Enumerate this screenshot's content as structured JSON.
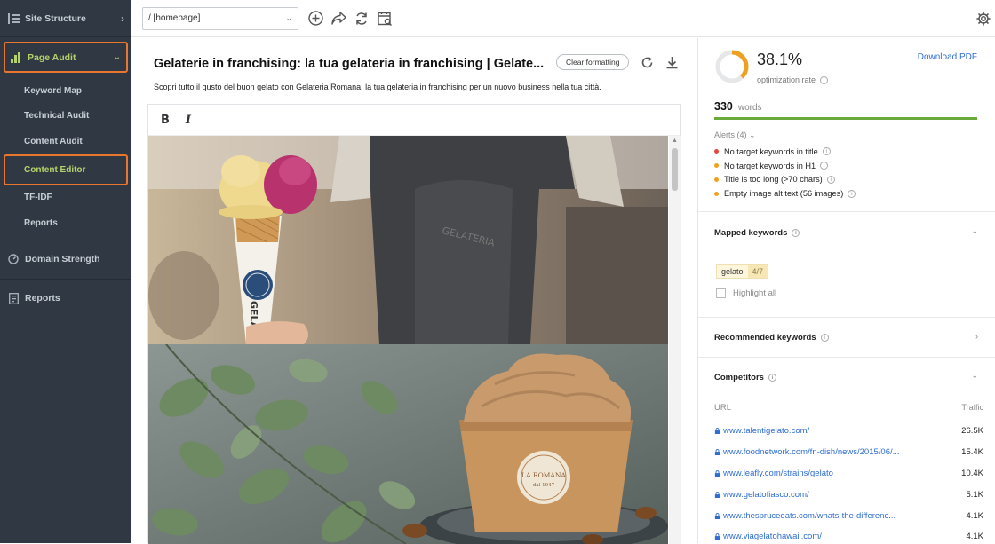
{
  "sidebar": {
    "site_structure": "Site Structure",
    "page_audit": "Page Audit",
    "sub_items": [
      "Keyword Map",
      "Technical Audit",
      "Content Audit",
      "Content Editor",
      "TF-IDF",
      "Reports"
    ],
    "domain_strength": "Domain Strength",
    "reports": "Reports"
  },
  "toolbar": {
    "url_value": "/ [homepage]",
    "icons": [
      "add-circle-icon",
      "share-icon",
      "refresh-icon",
      "calendar-search-icon"
    ],
    "settings_icon": "gear-icon"
  },
  "editor": {
    "title": "Gelaterie in franchising: la tua gelateria in franchising | Gelate...",
    "clear_formatting": "Clear formatting",
    "meta_description": "Scopri tutto il gusto del buon gelato con Gelateria Romana: la tua gelateria in franchising per un nuovo business nella tua città.",
    "bold_label": "B",
    "italic_label": "I",
    "cup_brand": "LA ROMANA",
    "cup_year": "dal 1947",
    "cone_text": "GELATO"
  },
  "panel": {
    "score_value": "38.1%",
    "score_fraction": 0.381,
    "score_label": "optimization rate",
    "download_pdf": "Download PDF",
    "word_count": "330",
    "words_label": "words",
    "alerts_header": "Alerts (4)",
    "alerts": [
      {
        "text": "No target keywords in title",
        "color": "#e5473b"
      },
      {
        "text": "No target keywords in H1",
        "color": "#f0a020"
      },
      {
        "text": "Title is too long (>70 chars)",
        "color": "#f0a020"
      },
      {
        "text": "Empty image alt text (56 images)",
        "color": "#f0a020"
      }
    ],
    "mapped_keywords": {
      "title": "Mapped keywords",
      "keyword": "gelato",
      "count": "4/7",
      "highlight_all": "Highlight all"
    },
    "recommended_keywords": {
      "title": "Recommended keywords"
    },
    "competitors": {
      "title": "Competitors",
      "url_header": "URL",
      "traffic_header": "Traffic",
      "rows": [
        {
          "url": "www.talentigelato.com/",
          "traffic": "26.5K"
        },
        {
          "url": "www.foodnetwork.com/fn-dish/news/2015/06/...",
          "traffic": "15.4K"
        },
        {
          "url": "www.leafly.com/strains/gelato",
          "traffic": "10.4K"
        },
        {
          "url": "www.gelatofiasco.com/",
          "traffic": "5.1K"
        },
        {
          "url": "www.thespruceeats.com/whats-the-differenc...",
          "traffic": "4.1K"
        },
        {
          "url": "www.viagelatohawaii.com/",
          "traffic": "4.1K"
        }
      ]
    },
    "accent_orange": "#f0a020",
    "link_color": "#2e6dd1",
    "progress_green": "#6aaa3b"
  }
}
